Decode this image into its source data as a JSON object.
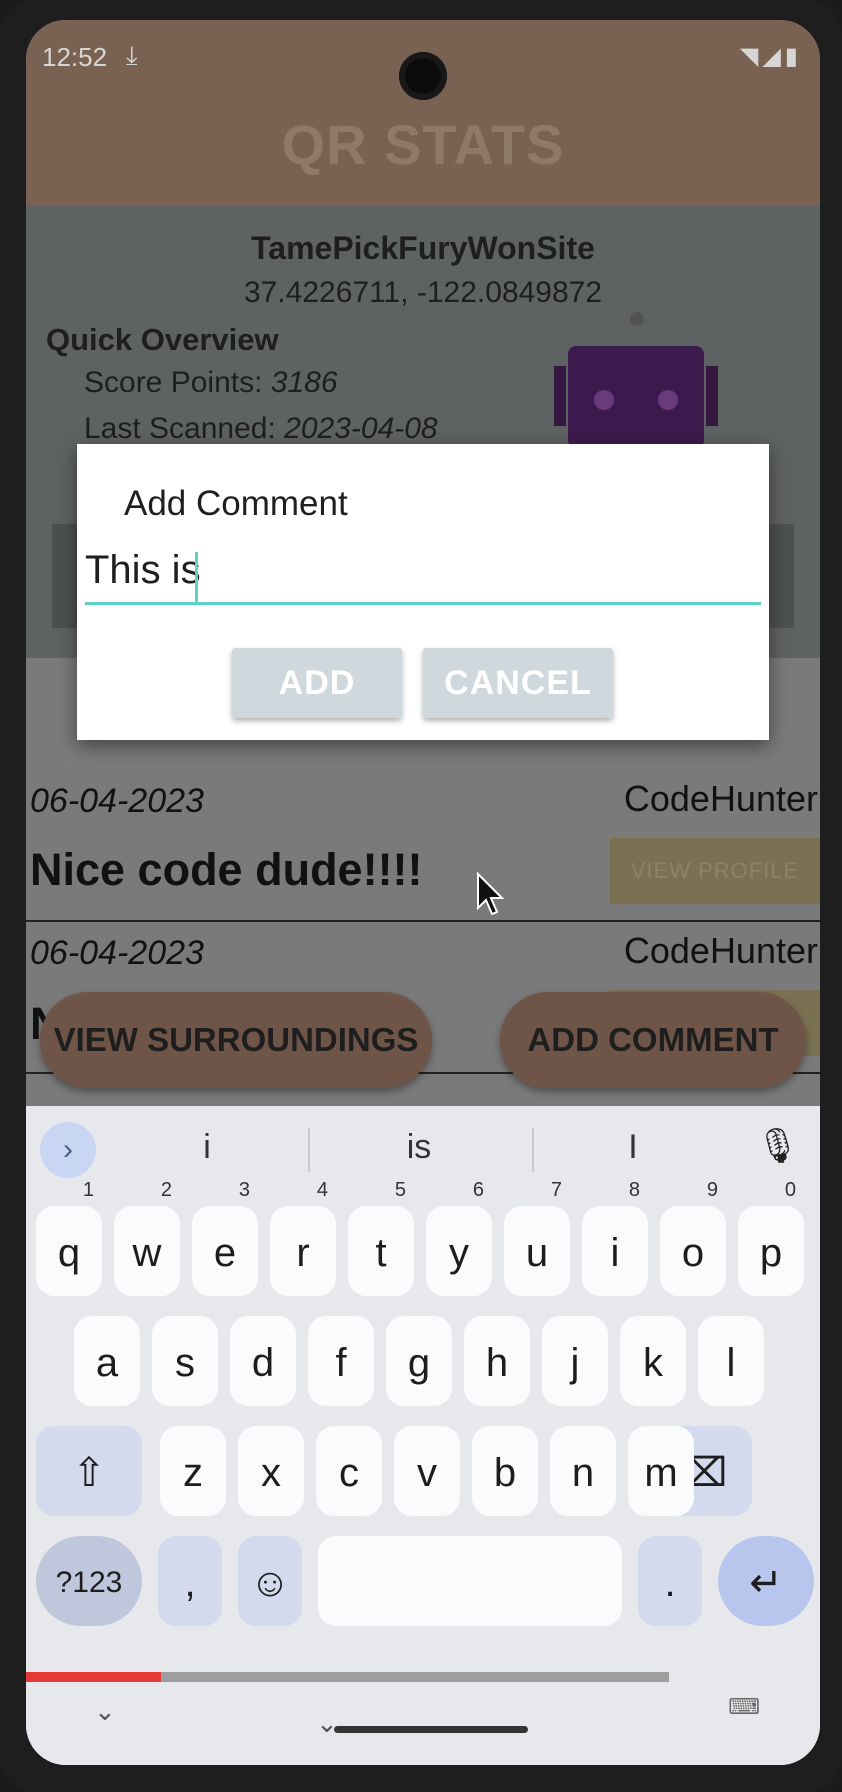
{
  "status": {
    "time": "12:52",
    "download_icon": "download-icon",
    "wifi_icon": "wifi-icon",
    "signal_icon": "signal-icon",
    "battery_icon": "battery-icon"
  },
  "app": {
    "title": "QR STATS"
  },
  "qr": {
    "name": "TamePickFuryWonSite",
    "coords": "37.4226711, -122.0849872",
    "overview_heading": "Quick Overview",
    "score_label": "Score Points: ",
    "score_value": "3186",
    "last_scanned_label": "Last Scanned: ",
    "last_scanned_value": "2023-04-08"
  },
  "comments": [
    {
      "date": "06-04-2023",
      "user": "CodeHunter",
      "text": "Nice code dude!!!!",
      "button": "VIEW PROFILE"
    },
    {
      "date": "06-04-2023",
      "user": "CodeHunter",
      "text": "Ni",
      "button": ""
    }
  ],
  "actions": {
    "view_surroundings": "VIEW SURROUNDINGS",
    "add_comment": "ADD COMMENT"
  },
  "dialog": {
    "title": "Add Comment",
    "input_value": "This is",
    "add_label": "ADD",
    "cancel_label": "CANCEL"
  },
  "keyboard": {
    "suggestions": [
      "i",
      "is",
      "I"
    ],
    "row1": [
      {
        "k": "q",
        "n": "1"
      },
      {
        "k": "w",
        "n": "2"
      },
      {
        "k": "e",
        "n": "3"
      },
      {
        "k": "r",
        "n": "4"
      },
      {
        "k": "t",
        "n": "5"
      },
      {
        "k": "y",
        "n": "6"
      },
      {
        "k": "u",
        "n": "7"
      },
      {
        "k": "i",
        "n": "8"
      },
      {
        "k": "o",
        "n": "9"
      },
      {
        "k": "p",
        "n": "0"
      }
    ],
    "row2": [
      "a",
      "s",
      "d",
      "f",
      "g",
      "h",
      "j",
      "k",
      "l"
    ],
    "row3": [
      "z",
      "x",
      "c",
      "v",
      "b",
      "n",
      "m"
    ],
    "sym_label": "?123",
    "comma": ",",
    "period": ".",
    "expand_icon": "chevron-right-icon",
    "mic_icon": "mic-icon",
    "shift_icon": "shift-icon",
    "backspace_icon": "backspace-icon",
    "emoji_icon": "emoji-icon",
    "enter_icon": "enter-icon"
  },
  "video_progress": {
    "played_fraction": 0.17,
    "buffered_fraction": 0.81
  },
  "colors": {
    "accent": "#5ed2c6",
    "progress": "#e53935",
    "header": "#7a6252"
  }
}
